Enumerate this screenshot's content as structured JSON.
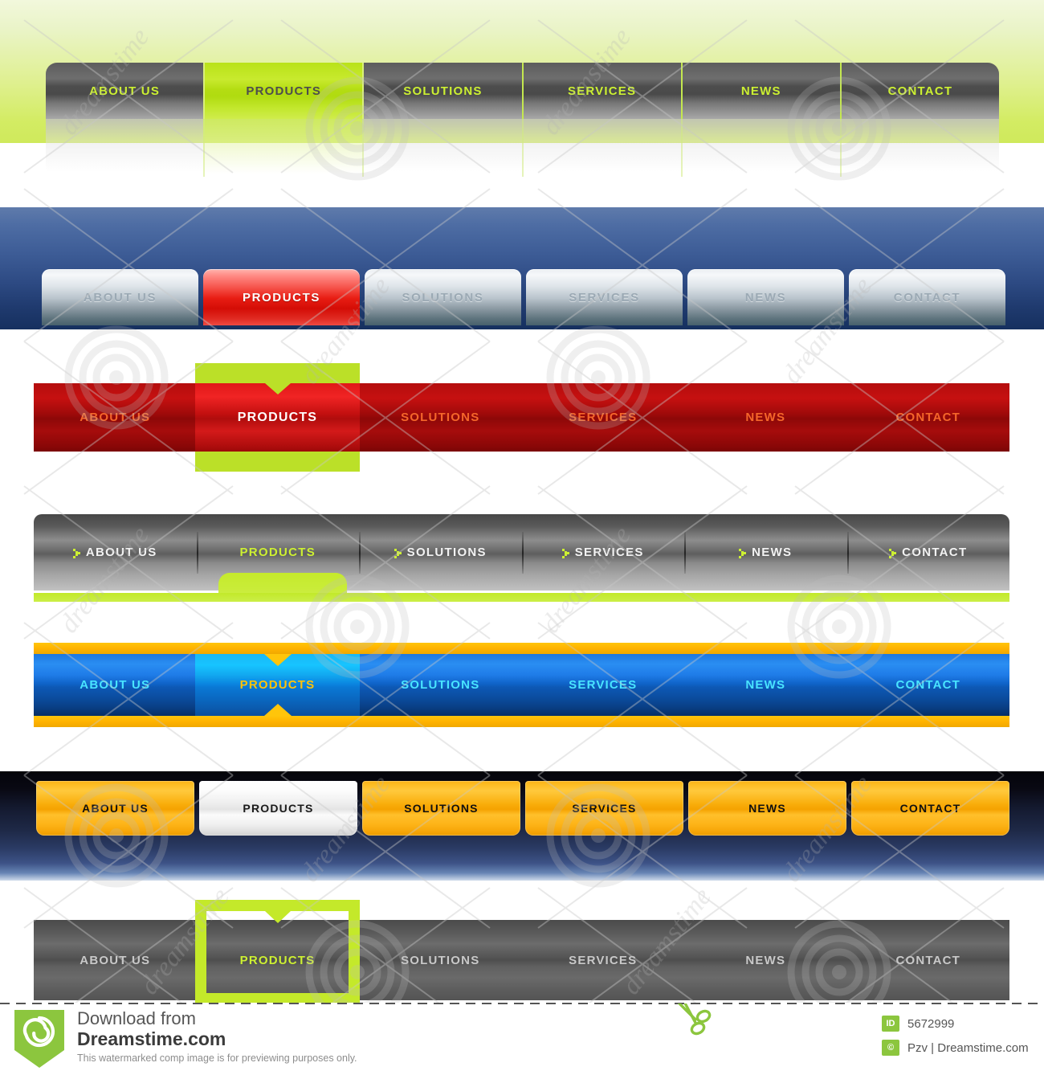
{
  "nav_labels": [
    "ABOUT US",
    "PRODUCTS",
    "SOLUTIONS",
    "SERVICES",
    "NEWS",
    "CONTACT"
  ],
  "active_label": "PRODUCTS",
  "bars": [
    {
      "name": "green-panel-gray-glossy-buttons",
      "items": [
        "ABOUT US",
        "PRODUCTS",
        "SOLUTIONS",
        "SERVICES",
        "NEWS",
        "CONTACT"
      ],
      "active_index": 1,
      "colors": {
        "panel": "#dff08f",
        "button": "#5d5d5d",
        "text": "#ccf032",
        "active_bg": "#b9e218",
        "active_text": "#4d4d4d",
        "separator": "#c4e84f"
      }
    },
    {
      "name": "blue-panel-silver-buttons",
      "items": [
        "ABOUT US",
        "PRODUCTS",
        "SOLUTIONS",
        "SERVICES",
        "NEWS",
        "CONTACT"
      ],
      "active_index": 1,
      "colors": {
        "panel": "#3d5c96",
        "button": "#dfe5ea",
        "text": "#9ba9b4",
        "active_bg": "#e81d13",
        "active_text": "#ffffff"
      }
    },
    {
      "name": "red-bar-lime-highlight",
      "items": [
        "ABOUT US",
        "PRODUCTS",
        "SOLUTIONS",
        "SERVICES",
        "NEWS",
        "CONTACT"
      ],
      "active_index": 1,
      "colors": {
        "bar": "#a60c0c",
        "text": "#f5662a",
        "active_bg": "#d41a1a",
        "active_text": "#ffffff",
        "frame": "#bbe028"
      }
    },
    {
      "name": "gray-bar-green-bullets",
      "items": [
        "ABOUT US",
        "PRODUCTS",
        "SOLUTIONS",
        "SERVICES",
        "NEWS",
        "CONTACT"
      ],
      "active_index": 1,
      "colors": {
        "bar": "#6f6f6f",
        "text": "#f2f2f2",
        "active_text": "#cdf032",
        "accent": "#c2e92a"
      }
    },
    {
      "name": "blue-bar-gold-rails",
      "items": [
        "ABOUT US",
        "PRODUCTS",
        "SOLUTIONS",
        "SERVICES",
        "NEWS",
        "CONTACT"
      ],
      "active_index": 1,
      "colors": {
        "bar": "#0d58b4",
        "text": "#49e4ff",
        "active_bg": "#0a78d4",
        "active_text": "#ffc20a",
        "rail": "#ffb300"
      }
    },
    {
      "name": "navy-panel-orange-tabs",
      "items": [
        "ABOUT US",
        "PRODUCTS",
        "SOLUTIONS",
        "SERVICES",
        "NEWS",
        "CONTACT"
      ],
      "active_index": 1,
      "colors": {
        "panel": "#1e2947",
        "button": "#f9ae0c",
        "text": "#101010",
        "active_bg": "#efefef",
        "active_text": "#1a1a1a"
      }
    },
    {
      "name": "dark-gray-bar-lime-outline",
      "items": [
        "ABOUT US",
        "PRODUCTS",
        "SOLUTIONS",
        "SERVICES",
        "NEWS",
        "CONTACT"
      ],
      "active_index": 1,
      "colors": {
        "bar": "#5c5c5c",
        "text": "#c9c9c9",
        "active_text": "#cdf032",
        "frame": "#c4e92a"
      }
    }
  ],
  "watermark": {
    "text": "dreamstime",
    "logo_icon": "spiral-icon"
  },
  "footer": {
    "download_from": "Download from",
    "site": "Dreamstime.com",
    "note": "This watermarked comp image is for previewing purposes only.",
    "logo_icon": "dreamstime-spiral-shield-icon",
    "scissors_icon": "scissors-icon",
    "id_chip": "ID",
    "id_value": "5672999",
    "copyright_chip": "©",
    "credit": "Pzv | Dreamstime.com",
    "accent_color": "#8cc63e"
  }
}
